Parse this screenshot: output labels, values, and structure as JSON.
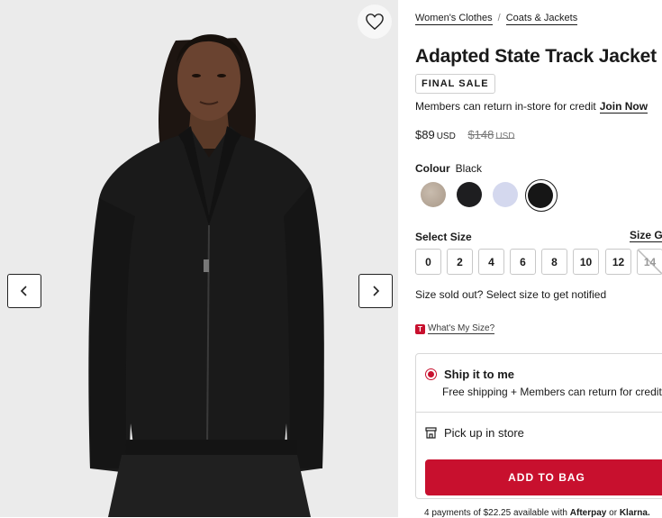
{
  "breadcrumb": [
    "Women's Clothes",
    "Coats & Jackets"
  ],
  "product": {
    "title": "Adapted State Track Jacket",
    "badge": "FINAL SALE",
    "member_text": "Members can return in-store for credit",
    "join_label": "Join Now",
    "price": "$89",
    "currency": "USD",
    "original_price": "$148",
    "original_currency": "USD"
  },
  "colour": {
    "label": "Colour",
    "selected": "Black",
    "swatches": [
      {
        "name": "beige-heather",
        "color": "#b8aa9a"
      },
      {
        "name": "black",
        "color": "#1e1e20"
      },
      {
        "name": "lavender",
        "color": "#d4d8ee"
      },
      {
        "name": "black-selected",
        "color": "#161616"
      }
    ]
  },
  "size": {
    "label": "Select Size",
    "guide_label": "Size G",
    "options": [
      "0",
      "2",
      "4",
      "6",
      "8",
      "10",
      "12",
      "14"
    ],
    "soldout": [
      "14"
    ],
    "soldout_text": "Size sold out? Select size to get notified",
    "whats_my_size": "What's My Size?",
    "whats_icon": "T"
  },
  "shipping": {
    "ship_label": "Ship it to me",
    "ship_sub": "Free shipping + Members can return for credit",
    "pickup_label": "Pick up in store",
    "add_to_bag": "ADD TO BAG",
    "payments_text": "4 payments of $22.25 available with",
    "afterpay": "Afterpay",
    "or_text": "or",
    "klarna": "Klarna."
  },
  "colors": {
    "accent": "#c8102e",
    "photo_bg": "#ebebeb"
  }
}
